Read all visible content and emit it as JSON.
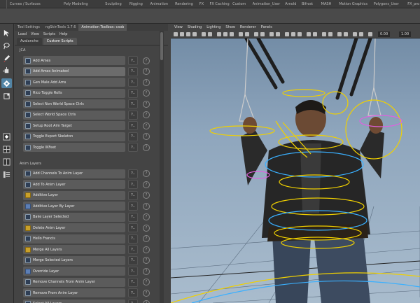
{
  "shelf": {
    "tabs": [
      "Curves / Surfaces",
      "Poly Modeling",
      "Sculpting",
      "Rigging",
      "Animation",
      "Rendering",
      "FX",
      "FX Caching",
      "Custom",
      "Animation_User",
      "Arnold",
      "Bifrost",
      "MASH",
      "Motion Graphics",
      "Polygons_User",
      "FX_pro"
    ]
  },
  "panel": {
    "tabs": [
      "Tool Settings",
      "ngSkinTools 1.7.6",
      "Animation Toolbox: cxob"
    ],
    "menu": [
      "Load",
      "View",
      "Scripts",
      "Help"
    ],
    "subtabs": [
      "Avalanche",
      "Custom Scripts"
    ],
    "sections": [
      {
        "header": "JCA",
        "items": [
          "Add Ames",
          "Add Ames Animated",
          "Gen Male Add Ams",
          "Rico Toggle Rolls",
          "Select Non World Space Ctrls",
          "Select World Space Ctrls",
          "Setup Root Aim Target",
          "Toggle Export Skeleton",
          "Toggle IKFeet"
        ]
      },
      {
        "header": "Anim Layers",
        "items": [
          "Add Channels To Anim Layer",
          "Add To Anim Layer",
          "Additive Layer",
          "Additive Layer By Layer",
          "Bake Layer Selected",
          "Delete Anim Layer",
          "Hello Francis",
          "Merge All Layers",
          "Merge Selected Layers",
          "Override Layer",
          "Remove Channels From Anim Layer",
          "Remove From Anim Layer",
          "Select All Layers"
        ]
      }
    ],
    "option_label": "?..",
    "info_label": "?"
  },
  "viewport": {
    "menu": [
      "View",
      "Shading",
      "Lighting",
      "Show",
      "Renderer",
      "Panels"
    ],
    "values": [
      "0.00",
      "1.00"
    ]
  },
  "colors": {
    "accent": "#5285a6",
    "control_yellow": "#f0d000",
    "control_blue": "#3ab0ff",
    "control_pink": "#e060e0"
  }
}
